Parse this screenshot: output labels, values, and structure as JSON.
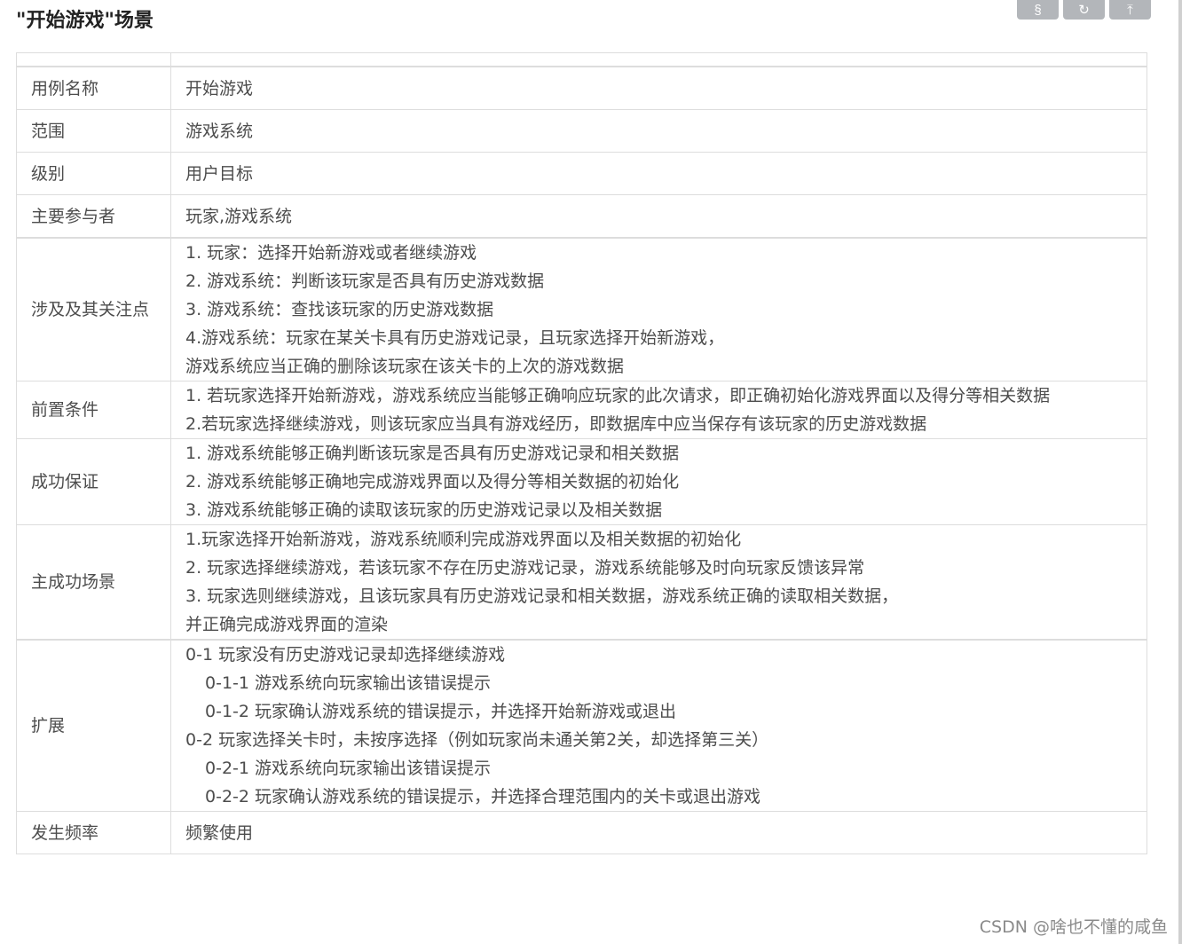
{
  "heading": "\"开始游戏\"场景",
  "toolbar": {
    "btn1_glyph": "§",
    "btn2_glyph": "↻",
    "btn3_glyph": "⤒"
  },
  "rows": {
    "name": {
      "label": "用例名称",
      "value": "开始游戏"
    },
    "scope": {
      "label": "范围",
      "value": "游戏系统"
    },
    "level": {
      "label": "级别",
      "value": "用户目标"
    },
    "actors": {
      "label": "主要参与者",
      "value": "玩家,游戏系统"
    },
    "stakeholders": {
      "label": "涉及及其关注点",
      "lines": [
        "1. 玩家：选择开始新游戏或者继续游戏",
        "2. 游戏系统：判断该玩家是否具有历史游戏数据",
        "3. 游戏系统：查找该玩家的历史游戏数据",
        "4.游戏系统：玩家在某关卡具有历史游戏记录，且玩家选择开始新游戏，",
        "游戏系统应当正确的删除该玩家在该关卡的上次的游戏数据"
      ]
    },
    "preconditions": {
      "label": "前置条件",
      "lines": [
        "1. 若玩家选择开始新游戏，游戏系统应当能够正确响应玩家的此次请求，即正确初始化游戏界面以及得分等相关数据",
        "2.若玩家选择继续游戏，则该玩家应当具有游戏经历，即数据库中应当保存有该玩家的历史游戏数据"
      ]
    },
    "guarantees": {
      "label": "成功保证",
      "lines": [
        "1. 游戏系统能够正确判断该玩家是否具有历史游戏记录和相关数据",
        "2. 游戏系统能够正确地完成游戏界面以及得分等相关数据的初始化",
        "3. 游戏系统能够正确的读取该玩家的历史游戏记录以及相关数据"
      ]
    },
    "main_scenario": {
      "label": "主成功场景",
      "lines": [
        "1.玩家选择开始新游戏，游戏系统顺利完成游戏界面以及相关数据的初始化",
        "2. 玩家选择继续游戏，若该玩家不存在历史游戏记录，游戏系统能够及时向玩家反馈该异常",
        "3. 玩家选则继续游戏，且该玩家具有历史游戏记录和相关数据，游戏系统正确的读取相关数据，",
        "并正确完成游戏界面的渲染"
      ]
    },
    "extensions": {
      "label": "扩展",
      "lines": [
        "0-1 玩家没有历史游戏记录却选择继续游戏",
        "0-1-1 游戏系统向玩家输出该错误提示",
        "0-1-2 玩家确认游戏系统的错误提示，并选择开始新游戏或退出",
        "0-2 玩家选择关卡时，未按序选择（例如玩家尚未通关第2关，却选择第三关）",
        "0-2-1 游戏系统向玩家输出该错误提示",
        "0-2-2 玩家确认游戏系统的错误提示，并选择合理范围内的关卡或退出游戏"
      ]
    },
    "frequency": {
      "label": "发生频率",
      "value": "频繁使用"
    }
  },
  "watermark": "CSDN @啥也不懂的咸鱼"
}
